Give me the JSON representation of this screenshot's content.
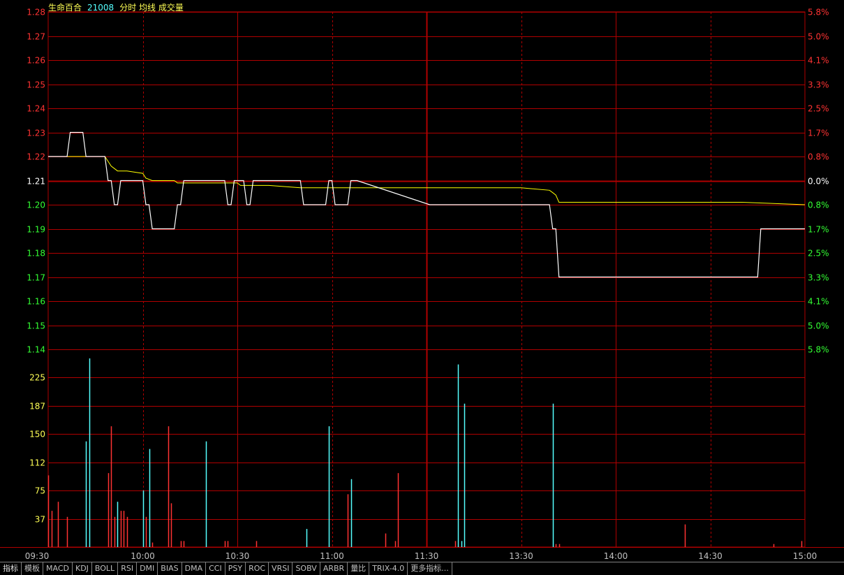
{
  "header": {
    "stock_name": "生命百合",
    "stock_code": "21008",
    "indicators": "分时 均线 成交量"
  },
  "colors": {
    "background": "#000000",
    "grid": "#b00000",
    "up": "#ff3333",
    "down": "#33ff33",
    "neutral": "#ffffff",
    "price_line": "#ffffff",
    "avg_line": "#ffff00",
    "volume_up": "#ff3333",
    "volume_down": "#55ffff",
    "volume_label": "#ffff55",
    "header_name": "#ffff55",
    "header_code": "#55ffff"
  },
  "tabs": [
    "指标",
    "模板",
    "MACD",
    "KDJ",
    "BOLL",
    "RSI",
    "DMI",
    "BIAS",
    "DMA",
    "CCI",
    "PSY",
    "ROC",
    "VRSI",
    "SOBV",
    "ARBR",
    "量比",
    "TRIX-4.0",
    "更多指标..."
  ],
  "chart_data": [
    {
      "type": "line",
      "title": "分时",
      "prev_close": 1.21,
      "ylim": [
        1.14,
        1.28
      ],
      "y_ticks": [
        "1.28",
        "1.27",
        "1.26",
        "1.25",
        "1.24",
        "1.23",
        "1.22",
        "1.21",
        "1.20",
        "1.19",
        "1.18",
        "1.17",
        "1.16",
        "1.15",
        "1.14"
      ],
      "pct_ticks": [
        "5.8%",
        "5.0%",
        "4.1%",
        "3.3%",
        "2.5%",
        "1.7%",
        "0.8%",
        "0.0%",
        "0.8%",
        "1.7%",
        "2.5%",
        "3.3%",
        "4.1%",
        "5.0%",
        "5.8%"
      ],
      "x_tick_labels": [
        "09:30",
        "10:00",
        "10:30",
        "11:00",
        "11:30",
        "13:30",
        "14:00",
        "14:30",
        "15:00"
      ],
      "series": [
        {
          "role": "price",
          "x": [
            0,
            6,
            7,
            11,
            12,
            18,
            19,
            20,
            21,
            22,
            23,
            24,
            25,
            30,
            31,
            32,
            33,
            40,
            41,
            42,
            43,
            56,
            57,
            58,
            59,
            60,
            61,
            62,
            63,
            64,
            65,
            66,
            67,
            80,
            81,
            82,
            83,
            88,
            89,
            90,
            91,
            92,
            93,
            95,
            96,
            97,
            98,
            121,
            122,
            123,
            124,
            141,
            142,
            143,
            144,
            145,
            146,
            147,
            148,
            149,
            150,
            159,
            160,
            161,
            162,
            219,
            220,
            221,
            225,
            226,
            227,
            240
          ],
          "values": [
            1.22,
            1.22,
            1.23,
            1.23,
            1.22,
            1.22,
            1.21,
            1.21,
            1.2,
            1.2,
            1.21,
            1.21,
            1.21,
            1.21,
            1.2,
            1.2,
            1.19,
            1.19,
            1.2,
            1.2,
            1.21,
            1.21,
            1.2,
            1.2,
            1.21,
            1.21,
            1.21,
            1.21,
            1.2,
            1.2,
            1.21,
            1.21,
            1.21,
            1.21,
            1.2,
            1.2,
            1.2,
            1.2,
            1.21,
            1.21,
            1.2,
            1.2,
            1.2,
            1.2,
            1.21,
            1.21,
            1.21,
            1.2,
            1.2,
            1.2,
            1.2,
            1.2,
            1.2,
            1.2,
            1.2,
            1.2,
            1.2,
            1.2,
            1.2,
            1.2,
            1.2,
            1.2,
            1.19,
            1.19,
            1.17,
            1.17,
            1.17,
            1.17,
            1.17,
            1.19,
            1.19,
            1.19
          ]
        },
        {
          "role": "average",
          "x": [
            0,
            18,
            19,
            20,
            21,
            22,
            25,
            30,
            31,
            33,
            40,
            41,
            60,
            61,
            70,
            80,
            90,
            100,
            120,
            141,
            150,
            159,
            160,
            161,
            162,
            180,
            200,
            220,
            240
          ],
          "values": [
            1.22,
            1.22,
            1.218,
            1.216,
            1.215,
            1.214,
            1.214,
            1.213,
            1.211,
            1.21,
            1.21,
            1.209,
            1.209,
            1.208,
            1.208,
            1.207,
            1.207,
            1.207,
            1.207,
            1.207,
            1.207,
            1.206,
            1.205,
            1.204,
            1.201,
            1.201,
            1.201,
            1.201,
            1.2
          ]
        }
      ]
    },
    {
      "type": "bar",
      "title": "成交量",
      "ylim": [
        0,
        262
      ],
      "y_ticks": [
        225,
        187,
        150,
        112,
        75,
        37
      ],
      "x": [
        0,
        1,
        3,
        6,
        12,
        13,
        19,
        20,
        21,
        22,
        23,
        24,
        25,
        30,
        31,
        32,
        33,
        38,
        39,
        42,
        43,
        50,
        56,
        57,
        66,
        82,
        89,
        95,
        96,
        107,
        110,
        111,
        129,
        130,
        131,
        132,
        160,
        161,
        162,
        202,
        230,
        239
      ],
      "values": [
        95,
        48,
        60,
        40,
        140,
        250,
        98,
        160,
        40,
        60,
        48,
        48,
        40,
        75,
        40,
        130,
        6,
        160,
        58,
        8,
        8,
        140,
        8,
        8,
        8,
        24,
        160,
        70,
        90,
        18,
        8,
        98,
        8,
        242,
        8,
        190,
        190,
        4,
        4,
        30,
        4,
        8
      ],
      "directions": [
        "up",
        "up",
        "up",
        "up",
        "down",
        "down",
        "up",
        "up",
        "up",
        "down",
        "up",
        "up",
        "up",
        "down",
        "up",
        "down",
        "up",
        "up",
        "up",
        "up",
        "up",
        "down",
        "up",
        "up",
        "up",
        "down",
        "down",
        "up",
        "down",
        "up",
        "up",
        "up",
        "up",
        "down",
        "down",
        "down",
        "down",
        "up",
        "up",
        "up",
        "up",
        "up"
      ]
    }
  ]
}
